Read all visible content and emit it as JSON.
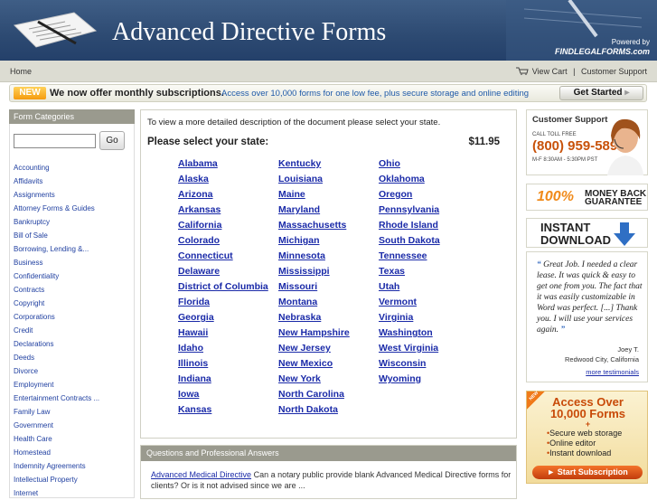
{
  "header": {
    "title": "Advanced Directive Forms",
    "powered_by": "Powered by",
    "powered_brand": "FINDLEGALFORMS.com"
  },
  "nav": {
    "home": "Home",
    "view_cart": "View Cart",
    "separator": "|",
    "customer_support": "Customer Support"
  },
  "promo": {
    "badge": "NEW",
    "message": "We now offer monthly subscriptions.",
    "sub": "Access over 10,000 forms for one low fee, plus secure storage and online editing",
    "button": "Get Started"
  },
  "sidebar": {
    "heading": "Form Categories",
    "search_placeholder": "",
    "go_label": "Go",
    "categories": [
      "Accounting",
      "Affidavits",
      "Assignments",
      "Attorney Forms & Guides",
      "Bankruptcy",
      "Bill of Sale",
      "Borrowing, Lending &...",
      "Business",
      "Confidentiality",
      "Contracts",
      "Copyright",
      "Corporations",
      "Credit",
      "Declarations",
      "Deeds",
      "Divorce",
      "Employment",
      "Entertainment Contracts ...",
      "Family Law",
      "Government",
      "Health Care",
      "Homestead",
      "Indemnity Agreements",
      "Intellectual Property",
      "Internet"
    ]
  },
  "main": {
    "intro": "To view a more detailed description of the document please select your state.",
    "please_select": "Please select your state:",
    "price": "$11.95",
    "states_col1": [
      "Alabama",
      "Alaska",
      "Arizona",
      "Arkansas",
      "California",
      "Colorado",
      "Connecticut",
      "Delaware",
      "District of Columbia",
      "Florida",
      "Georgia",
      "Hawaii",
      "Idaho",
      "Illinois",
      "Indiana",
      "Iowa",
      "Kansas"
    ],
    "states_col2": [
      "Kentucky",
      "Louisiana",
      "Maine",
      "Maryland",
      "Massachusetts",
      "Michigan",
      "Minnesota",
      "Mississippi",
      "Missouri",
      "Montana",
      "Nebraska",
      "New Hampshire",
      "New Jersey",
      "New Mexico",
      "New York",
      "North Carolina",
      "North Dakota"
    ],
    "states_col3": [
      "Ohio",
      "Oklahoma",
      "Oregon",
      "Pennsylvania",
      "Rhode Island",
      "South Dakota",
      "Tennessee",
      "Texas",
      "Utah",
      "Vermont",
      "Virginia",
      "Washington",
      "West Virginia",
      "Wisconsin",
      "Wyoming"
    ]
  },
  "qa": {
    "heading": "Questions and Professional Answers",
    "link": "Advanced Medical Directive",
    "text": " Can a notary public provide blank Advanced Medical Directive forms for clients? Or is it not advised since we are ..."
  },
  "right": {
    "cs_title": "Customer Support",
    "call_toll_free": "CALL TOLL FREE",
    "phone": "(800) 959-5899",
    "hours": "M-F 8:30AM - 5:30PM PST",
    "mb_pct": "100%",
    "mb_line1": "MONEY BACK",
    "mb_line2": "GUARANTEE",
    "instant1": "INSTANT",
    "instant2": "DOWNLOAD",
    "quote": "Great Job. I needed a clear lease. It was quick & easy to get one from you. The fact that it was easily customizable in Word was perfect. [...] Thank you. I will use your services again.",
    "author": "Joey T.",
    "location": "Redwood City, California",
    "more": "more testimonials",
    "ribbon": "NEW",
    "access1": "Access Over",
    "access2": "10,000 Forms",
    "plus": "+",
    "features": [
      "Secure web storage",
      "Online editor",
      "Instant download"
    ],
    "start": "Start Subscription"
  },
  "colors": {
    "header_bg": "#2d4a72",
    "link": "#1a2aa8",
    "accent_orange": "#f08a1a"
  }
}
